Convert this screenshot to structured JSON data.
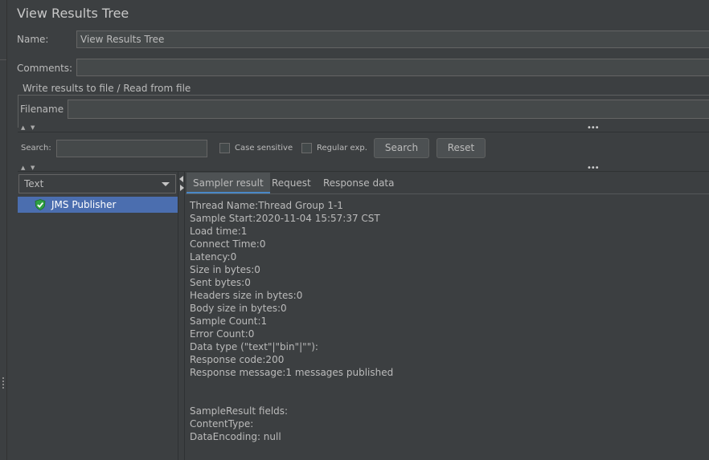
{
  "window": {
    "title": "View Results Tree"
  },
  "form": {
    "name_label": "Name:",
    "name_value": "View Results Tree",
    "comments_label": "Comments:",
    "comments_value": "",
    "file_group_title": "Write results to file / Read from file",
    "filename_label": "Filename",
    "filename_value": ""
  },
  "search": {
    "label": "Search:",
    "value": "",
    "case_sensitive_label": "Case sensitive",
    "case_sensitive_checked": false,
    "regex_label": "Regular exp.",
    "regex_checked": false,
    "search_button": "Search",
    "reset_button": "Reset"
  },
  "renderer": {
    "selected": "Text"
  },
  "tree": {
    "items": [
      {
        "label": "JMS Publisher",
        "status": "success",
        "icon": "shield-check-icon"
      }
    ]
  },
  "tabs": [
    {
      "label": "Sampler result",
      "active": true
    },
    {
      "label": "Request",
      "active": false
    },
    {
      "label": "Response data",
      "active": false
    }
  ],
  "sampler_result": {
    "lines": [
      "Thread Name:Thread Group 1-1",
      "Sample Start:2020-11-04 15:57:37 CST",
      "Load time:1",
      "Connect Time:0",
      "Latency:0",
      "Size in bytes:0",
      "Sent bytes:0",
      "Headers size in bytes:0",
      "Body size in bytes:0",
      "Sample Count:1",
      "Error Count:0",
      "Data type (\"text\"|\"bin\"|\"\"):",
      "Response code:200",
      "Response message:1 messages published",
      "",
      "",
      "SampleResult fields:",
      "ContentType:",
      "DataEncoding: null"
    ]
  },
  "colors": {
    "background": "#3c3f41",
    "selection": "#4b6eaf",
    "accent": "#4a88c7",
    "success": "#2ea043"
  }
}
